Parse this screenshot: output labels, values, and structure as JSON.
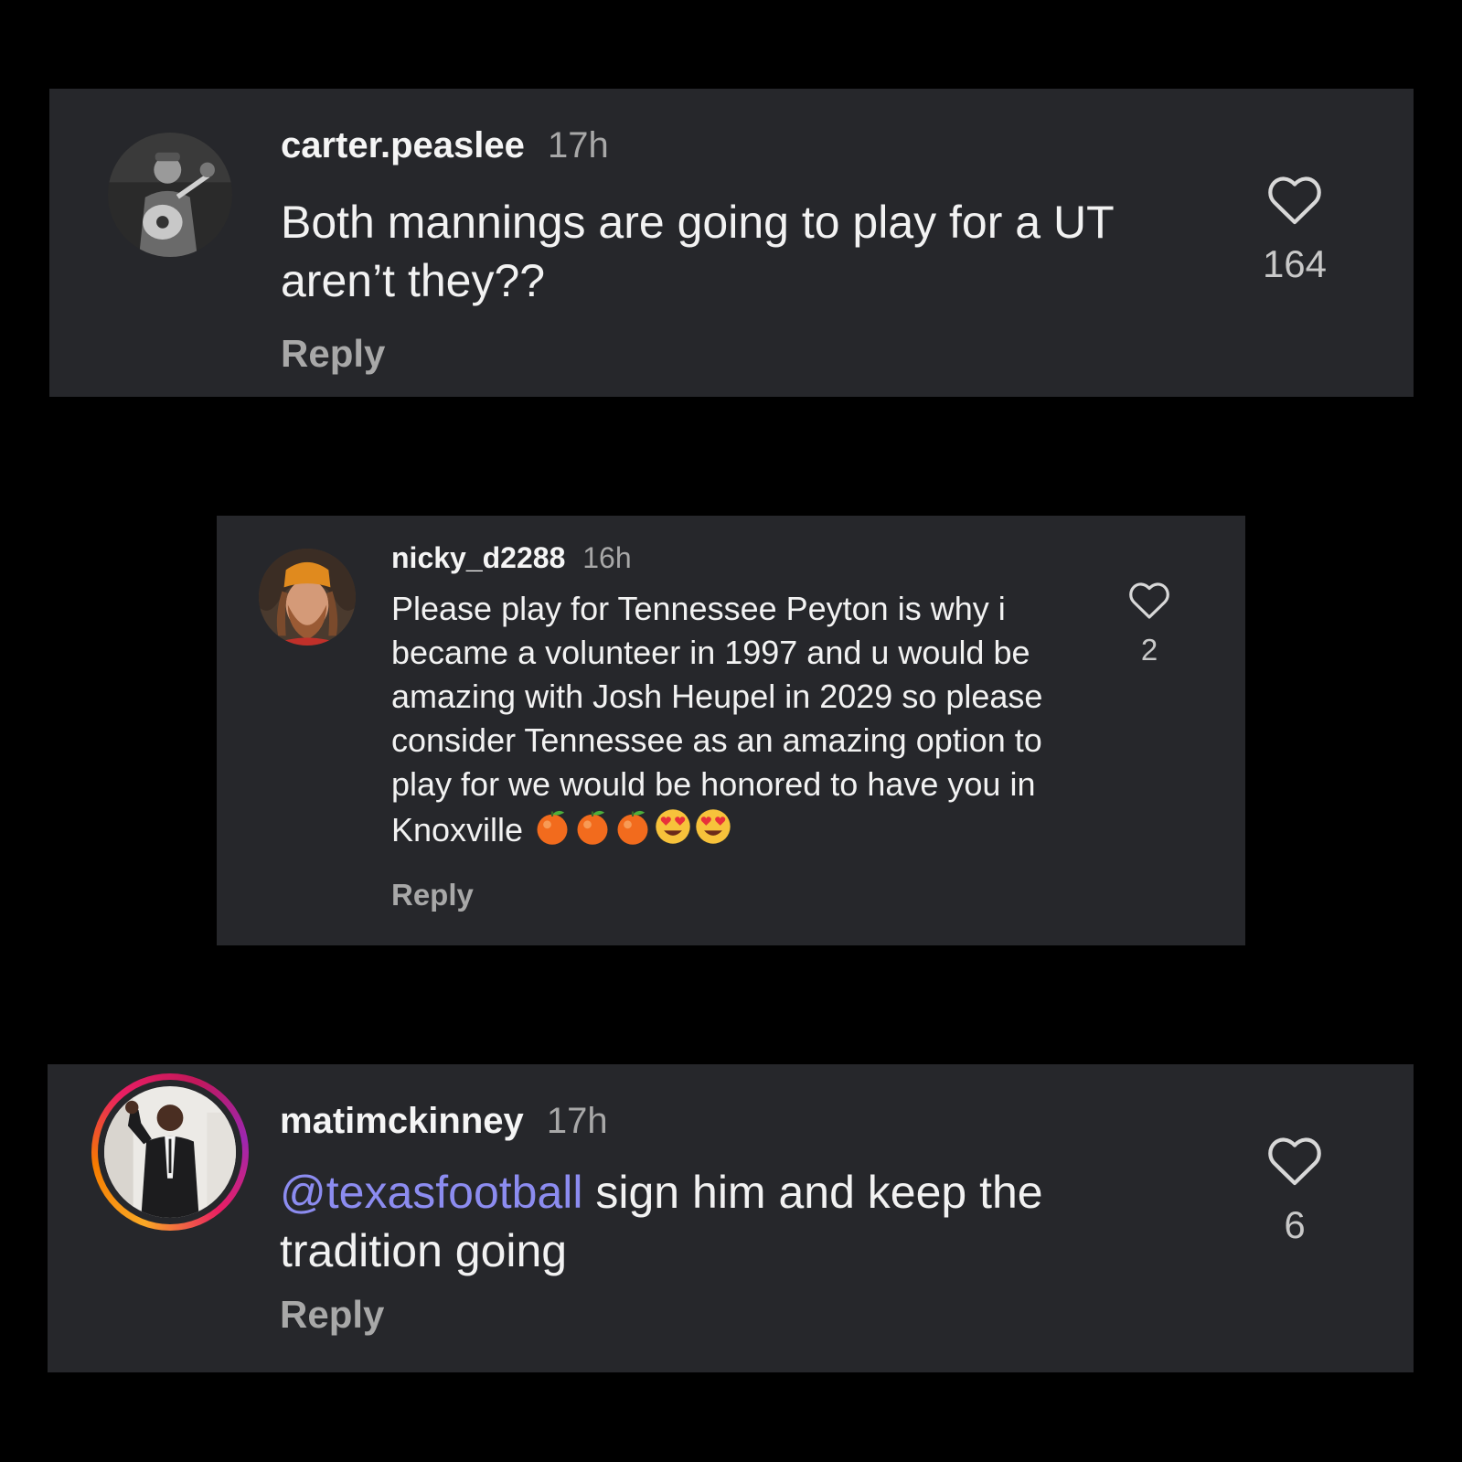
{
  "comments": [
    {
      "username": "carter.peaslee",
      "time": "17h",
      "text": "Both mannings are going to play for a UT aren’t they??",
      "reply_label": "Reply",
      "like_count": "164",
      "avatar": "guitar-player-photo"
    },
    {
      "username": "nicky_d2288",
      "time": "16h",
      "text": "Please play for Tennessee Peyton is why i became a volunteer in 1997 and u would be amazing with Josh Heupel in 2029 so please consider Tennessee as an amazing option to play for we would be honored to have you in Knoxville",
      "emojis": [
        "tangerine-emoji",
        "tangerine-emoji",
        "tangerine-emoji",
        "heart-eyes-emoji",
        "heart-eyes-emoji"
      ],
      "reply_label": "Reply",
      "like_count": "2",
      "avatar": "bearded-man-orange-beanie-photo"
    },
    {
      "username": "matimckinney",
      "time": "17h",
      "mention": "@texasfootball",
      "text": " sign him and keep the tradition going",
      "reply_label": "Reply",
      "like_count": "6",
      "avatar": "man-in-suit-photo",
      "story_ring": true
    }
  ],
  "colors": {
    "background": "#000000",
    "card": "#26272b",
    "mention": "#8c8cf0",
    "secondary_text": "#a8a8a8"
  }
}
